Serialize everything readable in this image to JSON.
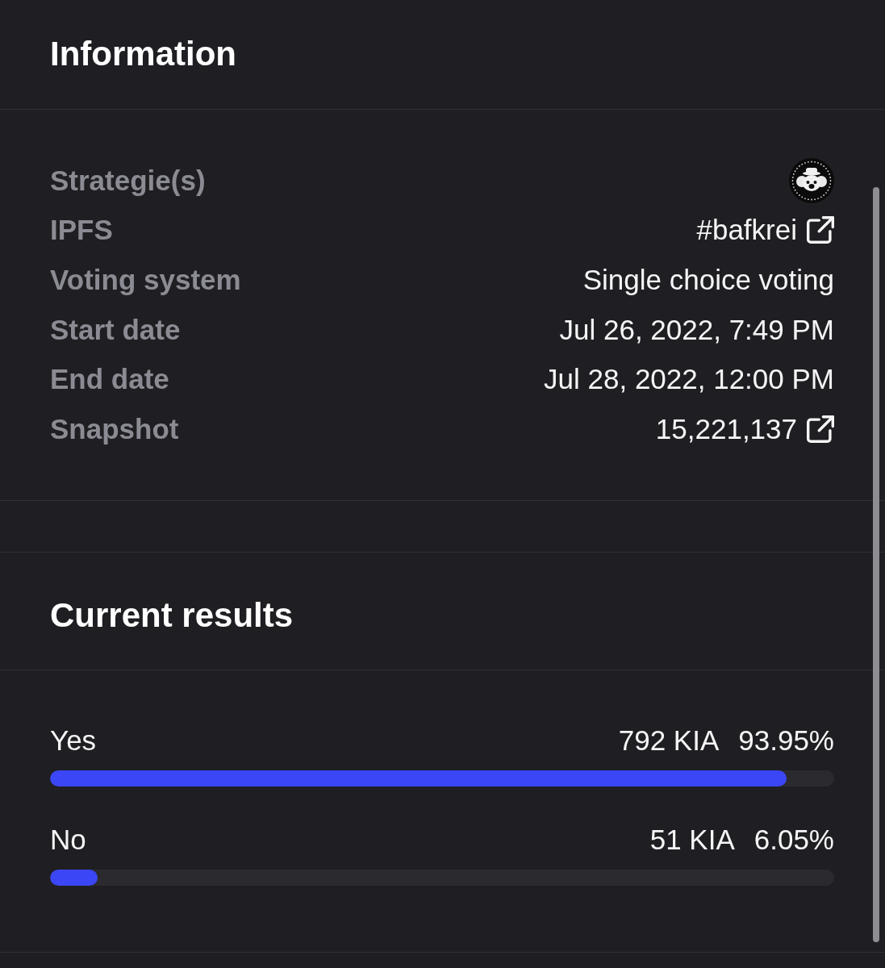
{
  "information": {
    "title": "Information",
    "rows": [
      {
        "label": "Strategie(s)",
        "kind": "avatar"
      },
      {
        "label": "IPFS",
        "value": "#bafkrei",
        "kind": "link"
      },
      {
        "label": "Voting system",
        "value": "Single choice voting",
        "kind": "text"
      },
      {
        "label": "Start date",
        "value": "Jul 26, 2022, 7:49 PM",
        "kind": "text"
      },
      {
        "label": "End date",
        "value": "Jul 28, 2022, 12:00 PM",
        "kind": "text"
      },
      {
        "label": "Snapshot",
        "value": "15,221,137",
        "kind": "link"
      }
    ]
  },
  "results": {
    "title": "Current results",
    "choices": [
      {
        "label": "Yes",
        "amount": "792 KIA",
        "percent": "93.95%",
        "level": 0.9395
      },
      {
        "label": "No",
        "amount": "51 KIA",
        "percent": "6.05%",
        "level": 0.0605
      }
    ]
  }
}
